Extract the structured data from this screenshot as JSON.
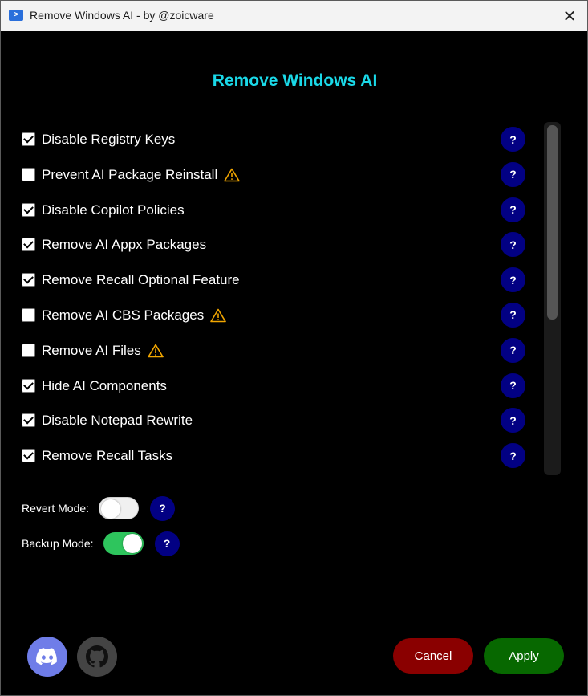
{
  "window": {
    "title": "Remove Windows AI - by @zoicware",
    "app_icon": "powershell-icon",
    "close_glyph": "✕"
  },
  "heading": "Remove Windows AI",
  "options": [
    {
      "label": "Disable Registry Keys",
      "checked": true,
      "warning": false
    },
    {
      "label": "Prevent AI Package Reinstall",
      "checked": false,
      "warning": true
    },
    {
      "label": "Disable Copilot Policies",
      "checked": true,
      "warning": false
    },
    {
      "label": "Remove AI Appx Packages",
      "checked": true,
      "warning": false
    },
    {
      "label": "Remove Recall Optional Feature",
      "checked": true,
      "warning": false
    },
    {
      "label": "Remove AI CBS Packages",
      "checked": false,
      "warning": true
    },
    {
      "label": "Remove AI Files",
      "checked": false,
      "warning": true
    },
    {
      "label": "Hide AI Components",
      "checked": true,
      "warning": false
    },
    {
      "label": "Disable Notepad Rewrite",
      "checked": true,
      "warning": false
    },
    {
      "label": "Remove Recall Tasks",
      "checked": true,
      "warning": false
    }
  ],
  "help_glyph": "?",
  "modes": {
    "revert": {
      "label": "Revert Mode:",
      "on": false
    },
    "backup": {
      "label": "Backup Mode:",
      "on": true
    }
  },
  "buttons": {
    "cancel": "Cancel",
    "apply": "Apply"
  },
  "colors": {
    "heading": "#1ad9e8",
    "help_bg": "#020083",
    "toggle_on": "#2ec55d",
    "cancel_bg": "#8a0000",
    "apply_bg": "#076800",
    "warning": "#f2a600"
  }
}
